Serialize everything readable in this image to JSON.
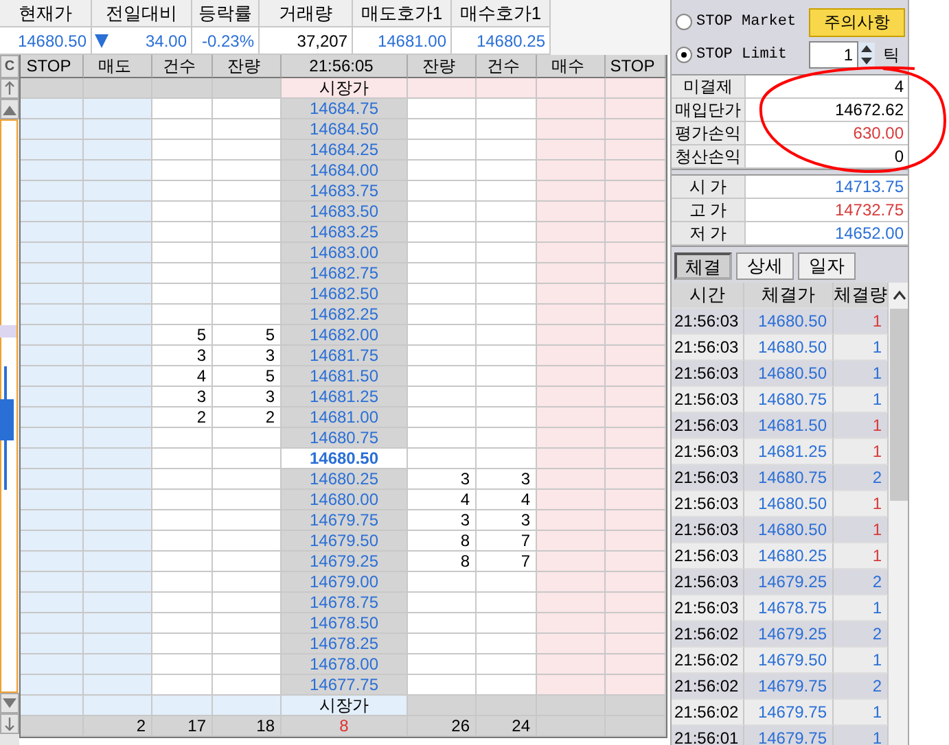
{
  "quote": {
    "columns": [
      {
        "label": "현재가",
        "value": "14680.50",
        "color": "#2a6fd6"
      },
      {
        "label": "전일대비",
        "value": "34.00",
        "color": "#2a6fd6",
        "falling": true
      },
      {
        "label": "등락률",
        "value": "-0.23%",
        "color": "#2a6fd6"
      },
      {
        "label": "거래량",
        "value": "37,207",
        "color": "#000000"
      },
      {
        "label": "매도호가1",
        "value": "14681.00",
        "color": "#2a6fd6"
      },
      {
        "label": "매수호가1",
        "value": "14680.25",
        "color": "#2a6fd6"
      }
    ]
  },
  "side_strip": {
    "button": "C"
  },
  "order_book": {
    "columns": [
      "STOP",
      "매도",
      "건수",
      "잔량",
      "21:56:05",
      "잔량",
      "건수",
      "매수",
      "STOP"
    ],
    "rows": [
      {
        "kind": "ask_market",
        "label": "시장가"
      },
      {
        "kind": "price",
        "price": "14684.75"
      },
      {
        "kind": "price",
        "price": "14684.50"
      },
      {
        "kind": "price",
        "price": "14684.25"
      },
      {
        "kind": "price",
        "price": "14684.00"
      },
      {
        "kind": "price",
        "price": "14683.75"
      },
      {
        "kind": "price",
        "price": "14683.50"
      },
      {
        "kind": "price",
        "price": "14683.25"
      },
      {
        "kind": "price",
        "price": "14683.00"
      },
      {
        "kind": "price",
        "price": "14682.75"
      },
      {
        "kind": "price",
        "price": "14682.50"
      },
      {
        "kind": "price",
        "price": "14682.25"
      },
      {
        "kind": "price",
        "price": "14682.00",
        "ask_count": "5",
        "ask_qty": "5"
      },
      {
        "kind": "price",
        "price": "14681.75",
        "ask_count": "3",
        "ask_qty": "3"
      },
      {
        "kind": "price",
        "price": "14681.50",
        "ask_count": "4",
        "ask_qty": "5"
      },
      {
        "kind": "price",
        "price": "14681.25",
        "ask_count": "3",
        "ask_qty": "3"
      },
      {
        "kind": "price",
        "price": "14681.00",
        "ask_count": "2",
        "ask_qty": "2"
      },
      {
        "kind": "price",
        "price": "14680.75"
      },
      {
        "kind": "current",
        "price": "14680.50"
      },
      {
        "kind": "price",
        "price": "14680.25",
        "bid_qty": "3",
        "bid_count": "3"
      },
      {
        "kind": "price",
        "price": "14680.00",
        "bid_qty": "4",
        "bid_count": "4"
      },
      {
        "kind": "price",
        "price": "14679.75",
        "bid_qty": "3",
        "bid_count": "3"
      },
      {
        "kind": "price",
        "price": "14679.50",
        "bid_qty": "8",
        "bid_count": "7"
      },
      {
        "kind": "price",
        "price": "14679.25",
        "bid_qty": "8",
        "bid_count": "7"
      },
      {
        "kind": "price",
        "price": "14679.00"
      },
      {
        "kind": "price",
        "price": "14678.75"
      },
      {
        "kind": "price",
        "price": "14678.50"
      },
      {
        "kind": "price",
        "price": "14678.25"
      },
      {
        "kind": "price",
        "price": "14678.00"
      },
      {
        "kind": "price",
        "price": "14677.75"
      },
      {
        "kind": "bid_market",
        "label": "시장가"
      }
    ],
    "totals": {
      "sell": "2",
      "ask_count": "17",
      "ask_qty": "18",
      "net": "8",
      "bid_qty": "26",
      "bid_count": "24"
    }
  },
  "stop_order": {
    "options": [
      {
        "label": "STOP Market",
        "selected": false
      },
      {
        "label": "STOP Limit",
        "selected": true
      }
    ],
    "notice_button": "주의사항",
    "ticks": {
      "value": "1",
      "unit": "틱"
    }
  },
  "position": [
    {
      "label": "미결제",
      "value": "4",
      "color": "#000000"
    },
    {
      "label": "매입단가",
      "value": "14672.62",
      "color": "#000000"
    },
    {
      "label": "평가손익",
      "value": "630.00",
      "color": "#d83a3a"
    },
    {
      "label": "청산손익",
      "value": "0",
      "color": "#000000"
    }
  ],
  "prices": [
    {
      "label": "시 가",
      "value": "14713.75",
      "color": "#2a6fd6"
    },
    {
      "label": "고 가",
      "value": "14732.75",
      "color": "#d83a3a"
    },
    {
      "label": "저 가",
      "value": "14652.00",
      "color": "#2a6fd6"
    }
  ],
  "trade_tabs": [
    {
      "label": "체결",
      "selected": true
    },
    {
      "label": "상세",
      "selected": false
    },
    {
      "label": "일자",
      "selected": false
    }
  ],
  "trades": {
    "columns": [
      "시간",
      "체결가",
      "체결량"
    ],
    "rows": [
      {
        "time": "21:56:03",
        "price": "14680.50",
        "qty": "1",
        "color": "#d83a3a"
      },
      {
        "time": "21:56:03",
        "price": "14680.50",
        "qty": "1",
        "color": "#2a6fd6"
      },
      {
        "time": "21:56:03",
        "price": "14680.50",
        "qty": "1",
        "color": "#2a6fd6"
      },
      {
        "time": "21:56:03",
        "price": "14680.75",
        "qty": "1",
        "color": "#2a6fd6"
      },
      {
        "time": "21:56:03",
        "price": "14681.50",
        "qty": "1",
        "color": "#d83a3a"
      },
      {
        "time": "21:56:03",
        "price": "14681.25",
        "qty": "1",
        "color": "#d83a3a"
      },
      {
        "time": "21:56:03",
        "price": "14680.75",
        "qty": "2",
        "color": "#2a6fd6"
      },
      {
        "time": "21:56:03",
        "price": "14680.50",
        "qty": "1",
        "color": "#d83a3a"
      },
      {
        "time": "21:56:03",
        "price": "14680.50",
        "qty": "1",
        "color": "#d83a3a"
      },
      {
        "time": "21:56:03",
        "price": "14680.25",
        "qty": "1",
        "color": "#d83a3a"
      },
      {
        "time": "21:56:03",
        "price": "14679.25",
        "qty": "2",
        "color": "#2a6fd6"
      },
      {
        "time": "21:56:03",
        "price": "14678.75",
        "qty": "1",
        "color": "#2a6fd6"
      },
      {
        "time": "21:56:02",
        "price": "14679.25",
        "qty": "2",
        "color": "#2a6fd6"
      },
      {
        "time": "21:56:02",
        "price": "14679.50",
        "qty": "1",
        "color": "#2a6fd6"
      },
      {
        "time": "21:56:02",
        "price": "14679.75",
        "qty": "2",
        "color": "#2a6fd6"
      },
      {
        "time": "21:56:02",
        "price": "14679.75",
        "qty": "1",
        "color": "#2a6fd6"
      },
      {
        "time": "21:56:01",
        "price": "14679.75",
        "qty": "1",
        "color": "#2a6fd6"
      }
    ]
  },
  "annotations": [
    {
      "kind": "loop"
    }
  ]
}
